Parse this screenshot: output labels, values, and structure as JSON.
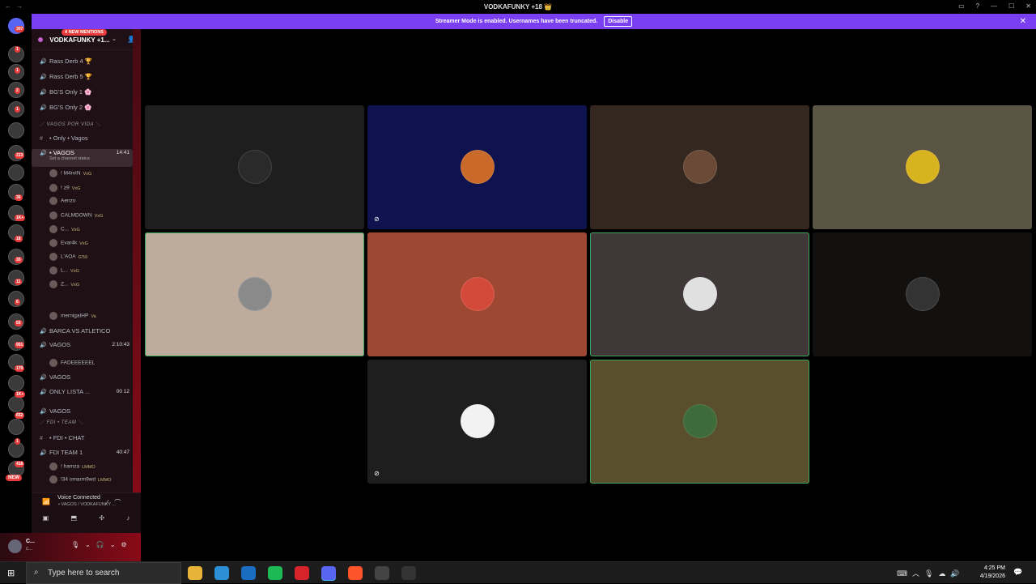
{
  "window": {
    "title": "VODKAFUNKY +18 👑",
    "controls": [
      "▭",
      "?",
      "—",
      "☐",
      "✕"
    ]
  },
  "banner": {
    "text": "Streamer Mode is enabled. Usernames have been truncated.",
    "button": "Disable"
  },
  "server_rail": {
    "home_badge": "307",
    "badges": [
      "1",
      "1",
      "2",
      "1",
      "213",
      "36",
      "1K+",
      "18",
      "35",
      "11",
      "6",
      "50",
      "901",
      "179",
      "1K+",
      "652",
      "1",
      "418"
    ],
    "new_label": "NEW"
  },
  "guild": {
    "name": "VODKAFUNKY +1..."
  },
  "channels": [
    {
      "kind": "voice",
      "label": "Rass Derb 4 🏆"
    },
    {
      "kind": "voice",
      "label": "Rass Derb 5 🏆"
    },
    {
      "kind": "voice",
      "label": "BG'S Only 1 🌸"
    },
    {
      "kind": "voice",
      "label": "BG'S Only 2 🌸"
    },
    {
      "kind": "category",
      "label": "⋰ VAGOS POR VIDA ⋱"
    },
    {
      "kind": "text",
      "label": "• Only • Vagos"
    },
    {
      "kind": "voice-active",
      "label": "• VAGOS",
      "time": "14:41",
      "sub": "Set a channel status"
    },
    {
      "kind": "user",
      "label": "! M4rvIN",
      "tag": "VxG"
    },
    {
      "kind": "user",
      "label": "! ≥9",
      "tag": "VxG"
    },
    {
      "kind": "user",
      "label": "Aenzo",
      "tag": ""
    },
    {
      "kind": "user",
      "label": "CALMDOWN",
      "tag": "VxG"
    },
    {
      "kind": "user",
      "label": "C...",
      "tag": "VxG"
    },
    {
      "kind": "user",
      "label": "Evar4k",
      "tag": "VxG"
    },
    {
      "kind": "user",
      "label": "L'AOA",
      "tag": "G'59"
    },
    {
      "kind": "user",
      "label": "L...",
      "tag": "VxG"
    },
    {
      "kind": "user",
      "label": "Z...",
      "tag": "VxG"
    },
    {
      "kind": "user",
      "label": "mernigaIHP",
      "tag": "Va"
    },
    {
      "kind": "voice",
      "label": "BARCA VS ATLETICO"
    },
    {
      "kind": "voice",
      "label": "VAGOS",
      "time": "2:10:43"
    },
    {
      "kind": "user",
      "label": "FADEEEEEEL",
      "tag": ""
    },
    {
      "kind": "voice",
      "label": "VAGOS"
    },
    {
      "kind": "voice",
      "label": "ONLY LISTA ...",
      "time": "00 12"
    },
    {
      "kind": "voice",
      "label": "VAGOS"
    },
    {
      "kind": "category",
      "label": "⋰ FDI • TEAM ⋱"
    },
    {
      "kind": "text",
      "label": "• FDI • CHAT"
    },
    {
      "kind": "voice",
      "label": "FDI TEAM 1",
      "time": "40:47"
    },
    {
      "kind": "user",
      "label": "! hamza",
      "tag": "LMMO"
    },
    {
      "kind": "user",
      "label": "!34 omarm9wd",
      "tag": "LMMO"
    },
    {
      "kind": "mentions",
      "label": "4 NEW MENTIONS"
    }
  ],
  "voice_panel": {
    "status": "Voice Connected",
    "detail": "• VAGOS / VODKAFUNKY ..."
  },
  "user_panel": {
    "name": "C...",
    "status": "c..."
  },
  "tiles": [
    {
      "bg": "#1e1e1e",
      "avatar": "#2a2a2a",
      "speaking": false,
      "deafened": false
    },
    {
      "bg": "#0e1350",
      "avatar": "#c9692a",
      "speaking": false,
      "deafened": true
    },
    {
      "bg": "#33271f",
      "avatar": "#6a4a36",
      "speaking": false,
      "deafened": false
    },
    {
      "bg": "#5a5445",
      "avatar": "#d8b320",
      "speaking": false,
      "deafened": false
    },
    {
      "bg": "#bdac9c",
      "avatar": "#8a8a8a",
      "speaking": true,
      "deafened": false
    },
    {
      "bg": "#9c4832",
      "avatar": "#d44a3a",
      "speaking": false,
      "deafened": false
    },
    {
      "bg": "#403838",
      "avatar": "#e0e0e0",
      "speaking": true,
      "deafened": false
    },
    {
      "bg": "#121110",
      "avatar": "#333333",
      "speaking": false,
      "deafened": false
    },
    {
      "bg": "#1e1e1e",
      "avatar": "#f2f2f2",
      "speaking": false,
      "deafened": true
    },
    {
      "bg": "#5a4f2c",
      "avatar": "#3e6b3a",
      "speaking": true,
      "deafened": false
    }
  ],
  "taskbar": {
    "search_placeholder": "Type here to search",
    "time": "4:25 PM",
    "date": "4/19/2026",
    "apps": [
      {
        "name": "file-explorer",
        "color": "#e8b339"
      },
      {
        "name": "microsoft-store",
        "color": "#2d8fd6"
      },
      {
        "name": "outlook",
        "color": "#1b6dc1"
      },
      {
        "name": "spotify",
        "color": "#1db954"
      },
      {
        "name": "acrobat",
        "color": "#d7242a"
      },
      {
        "name": "discord",
        "color": "#5865f2"
      },
      {
        "name": "brave",
        "color": "#fb542b"
      },
      {
        "name": "app-game",
        "color": "#444444"
      },
      {
        "name": "app-obs",
        "color": "#333333"
      }
    ]
  }
}
